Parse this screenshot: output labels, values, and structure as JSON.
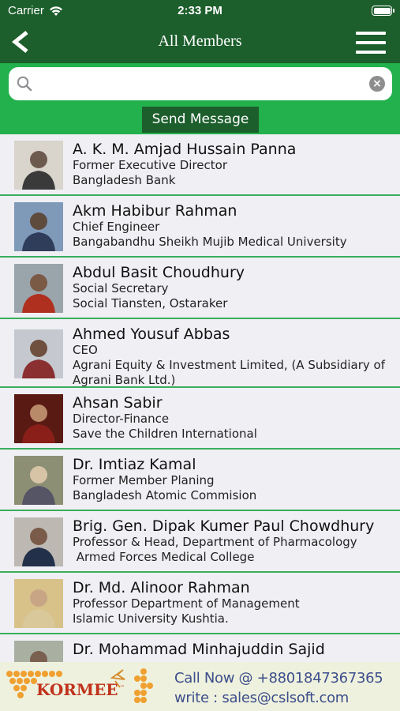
{
  "status_bar": {
    "carrier": "Carrier",
    "time": "2:33 PM"
  },
  "nav": {
    "title": "All Members"
  },
  "search": {
    "placeholder": "",
    "value": ""
  },
  "actions": {
    "send_message": "Send Message"
  },
  "members": [
    {
      "name": "A. K. M. Amjad Hussain Panna",
      "lines": [
        "Former Executive Director",
        "Bangladesh Bank"
      ]
    },
    {
      "name": "Akm Habibur Rahman",
      "lines": [
        "Chief Engineer",
        "Bangabandhu Sheikh Mujib Medical University"
      ]
    },
    {
      "name": "Abdul Basit Choudhury",
      "lines": [
        "Social Secretary",
        "Social Tiansten, Ostaraker"
      ]
    },
    {
      "name": "Ahmed Yousuf Abbas",
      "lines": [
        "CEO",
        "Agrani Equity & Investment Limited, (A Subsidiary of",
        "Agrani Bank Ltd.)"
      ]
    },
    {
      "name": "Ahsan Sabir",
      "lines": [
        "Director-Finance",
        "Save the Children International"
      ]
    },
    {
      "name": "Dr. Imtiaz Kamal",
      "lines": [
        "Former Member Planing",
        "Bangladesh Atomic Commision"
      ]
    },
    {
      "name": "Brig. Gen. Dipak Kumer Paul Chowdhury",
      "lines": [
        "Professor & Head, Department of Pharmacology",
        " Armed Forces Medical College"
      ]
    },
    {
      "name": "Dr. Md. Alinoor Rahman",
      "lines": [
        "Professor Department of Management",
        "Islamic University Kushtia."
      ]
    },
    {
      "name": "Dr. Mohammad Minhajuddin Sajid",
      "lines": []
    }
  ],
  "footer": {
    "brand": "KORMEE",
    "call": "Call Now @ +8801847367365",
    "write": "write : sales@cslsoft.com"
  },
  "colors": {
    "header": "#1c5e2c",
    "accent": "#22b14c",
    "divider": "#3aae5a"
  },
  "icons": {
    "back": "chevron-left-icon",
    "menu": "hamburger-menu-icon",
    "search": "search-icon",
    "clear": "clear-icon"
  }
}
